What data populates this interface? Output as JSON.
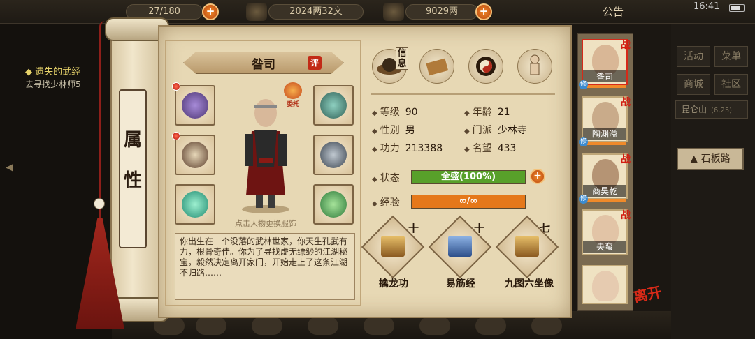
{
  "topbar": {
    "res1": "27/180",
    "res2": "2024两32文",
    "res3": "9029两",
    "notice": "公告",
    "clock": "16:41"
  },
  "quest": {
    "title": "遗失的武经",
    "desc": "去寻找少林师5"
  },
  "scroll": {
    "label": "属性"
  },
  "character": {
    "name": "昝司",
    "rate_label": "评",
    "entrust_label": "委托",
    "change_hint": "点击人物更换服饰",
    "bio": "你出生在一个没落的武林世家，你天生孔武有力，根骨奇佳。你为了寻找虚无缥缈的江湖秘宝，毅然决定离开家门，开始走上了这条江湖不归路……"
  },
  "tabs": {
    "info_label": "信息"
  },
  "stats": {
    "level_label": "等级",
    "level": "90",
    "age_label": "年龄",
    "age": "21",
    "gender_label": "性别",
    "gender": "男",
    "sect_label": "门派",
    "sect": "少林寺",
    "power_label": "功力",
    "power": "213388",
    "fame_label": "名望",
    "fame": "433",
    "status_label": "状态",
    "status_value": "全盛(100%)",
    "status_fill": 1.0,
    "exp_label": "经验",
    "exp_value": "∞/∞",
    "exp_fill": 1.0
  },
  "skills": [
    {
      "name": "擒龙功",
      "level": "十"
    },
    {
      "name": "易筋经",
      "level": "十"
    },
    {
      "name": "九图六坐像",
      "level": "七"
    }
  ],
  "party": [
    {
      "name": "昝司",
      "mark": "战",
      "tag": "修"
    },
    {
      "name": "陶渊溢",
      "mark": "战",
      "tag": "修"
    },
    {
      "name": "商昊乾",
      "mark": "战",
      "tag": "修"
    },
    {
      "name": "央蛮",
      "mark": "战",
      "tag": ""
    },
    {
      "name": "",
      "mark": "",
      "tag": ""
    }
  ],
  "leave_label": "离开",
  "right_menu": {
    "activity": "活动",
    "menu": "菜单",
    "shop": "商城",
    "community": "社区",
    "location": "昆仑山",
    "coords": "(6,25)",
    "path": "石板路"
  },
  "colors": {
    "status_bar": "#58a02a",
    "exp_bar": "#e5781a",
    "accent_red": "#d21e12"
  }
}
